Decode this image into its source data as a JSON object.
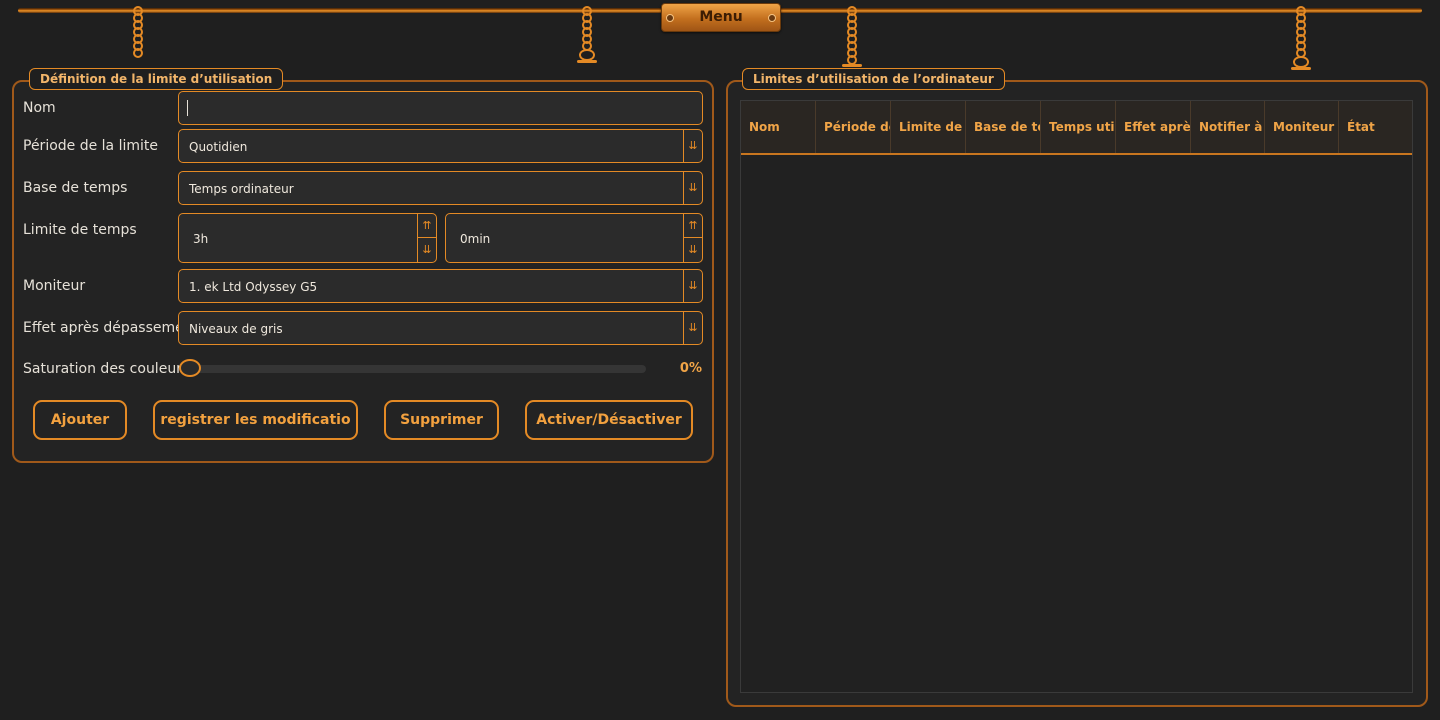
{
  "menu": {
    "label": "Menu"
  },
  "form": {
    "title": "Définition de la limite d’utilisation",
    "name": {
      "label": "Nom",
      "value": ""
    },
    "period": {
      "label": "Période de la limite",
      "value": "Quotidien"
    },
    "time_base": {
      "label": "Base de temps",
      "value": "Temps ordinateur"
    },
    "time_limit": {
      "label": "Limite de temps",
      "hours": "3h",
      "minutes": "0min"
    },
    "monitor": {
      "label": "Moniteur",
      "value": "1. ek Ltd Odyssey G5"
    },
    "effect": {
      "label": "Effet après dépassement",
      "value": "Niveaux de gris"
    },
    "saturation": {
      "label": "Saturation des couleurs",
      "value": "0%",
      "level": 0
    },
    "buttons": {
      "add": "Ajouter",
      "save": "registrer les modificatio",
      "delete": "Supprimer",
      "toggle": "Activer/Désactiver"
    }
  },
  "table_panel": {
    "title": "Limites d’utilisation de l’ordinateur",
    "columns": [
      "Nom",
      "Période de",
      "Limite de t",
      "Base de te",
      "Temps util",
      "Effet après",
      "Notifier à l",
      "Moniteur",
      "État"
    ],
    "rows": []
  },
  "icons": {
    "combo_arrow": "double-down-arrow-icon",
    "spin_up": "double-up-arrow-icon",
    "spin_down": "double-down-arrow-icon"
  },
  "colors": {
    "accent": "#e48a25",
    "background": "#1f1f1f",
    "header_text": "#f0a447"
  }
}
